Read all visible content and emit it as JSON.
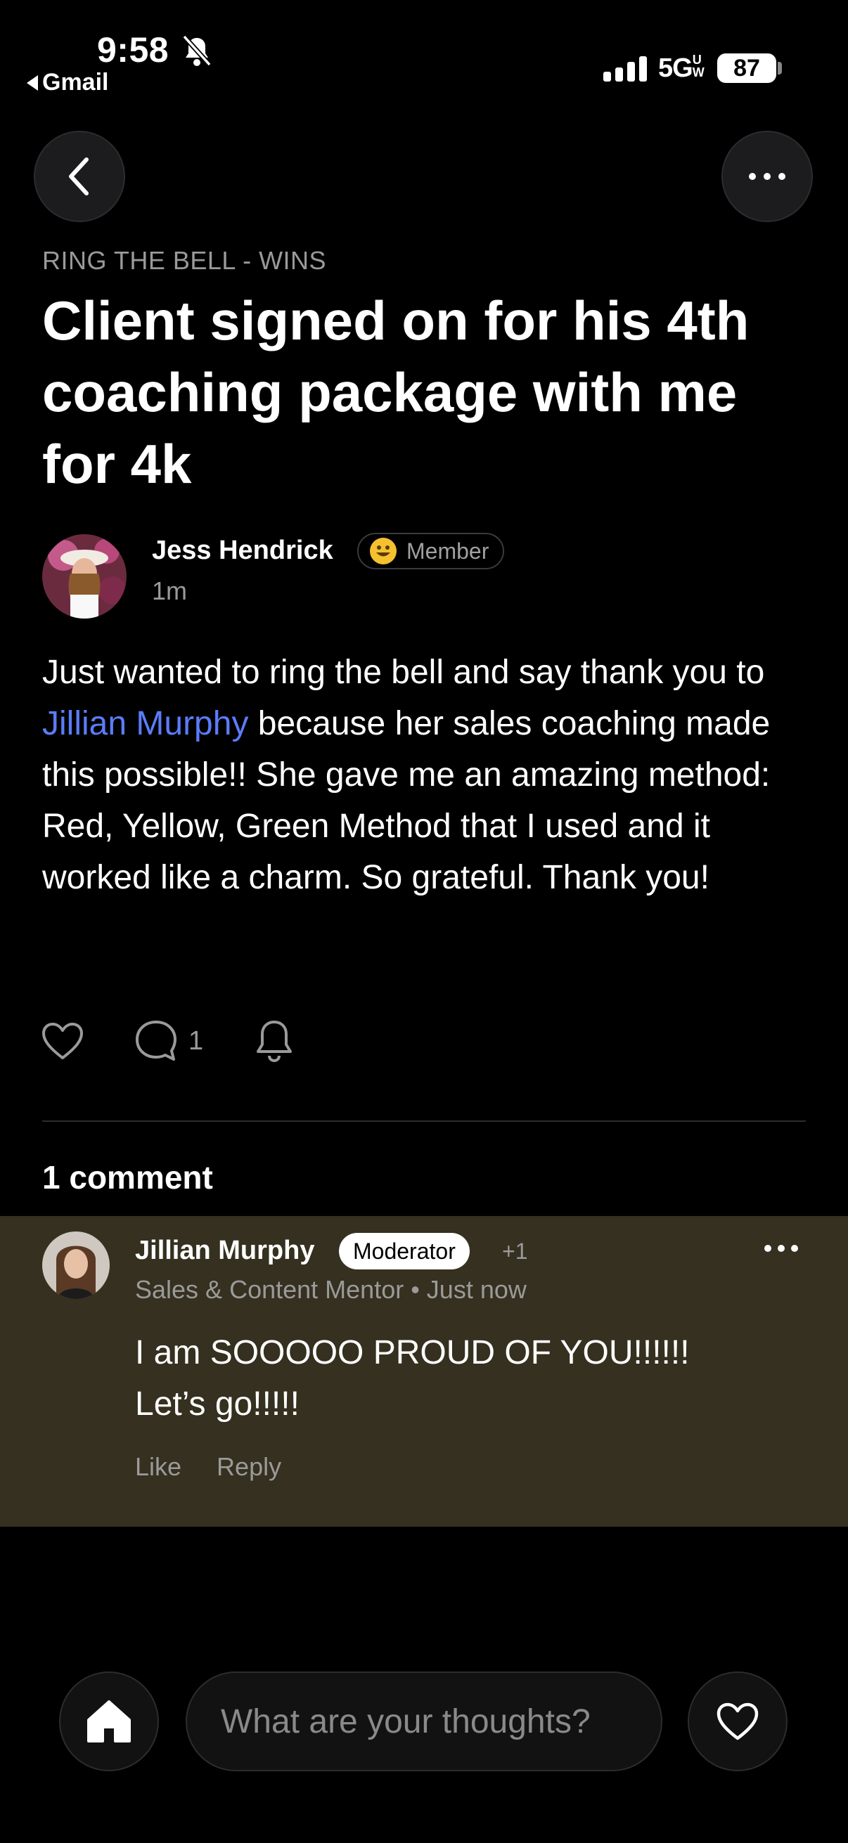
{
  "status_bar": {
    "time": "9:58",
    "back_app": "Gmail",
    "network": "5G",
    "network_suffix": "UW",
    "battery": "87"
  },
  "post": {
    "category": "RING THE BELL - WINS",
    "title": "Client signed on for his 4th coaching package with me for 4k",
    "author": {
      "name": "Jess Hendrick",
      "badge": "Member",
      "time": "1m"
    },
    "body_before": "Just wanted to ring the bell and say thank you to ",
    "mention": "Jillian Murphy",
    "body_after": " because her sales coaching made this possible!! She gave me an amazing method: Red, Yellow, Green Method that I used and it worked like a charm. So grateful. Thank you!",
    "comment_count": "1"
  },
  "comments": {
    "heading": "1 comment",
    "items": [
      {
        "name": "Jillian Murphy",
        "badge": "Moderator",
        "extra": "+1",
        "subtitle": "Sales & Content Mentor • Just now",
        "line1": "I am SOOOOO PROUD OF YOU!!!!!!",
        "line2": "Let’s go!!!!!",
        "like": "Like",
        "reply": "Reply"
      }
    ]
  },
  "bottom_bar": {
    "placeholder": "What are your thoughts?"
  },
  "colors": {
    "background": "#000000",
    "mention": "#5b7cfa",
    "comment_highlight": "#35301f"
  }
}
